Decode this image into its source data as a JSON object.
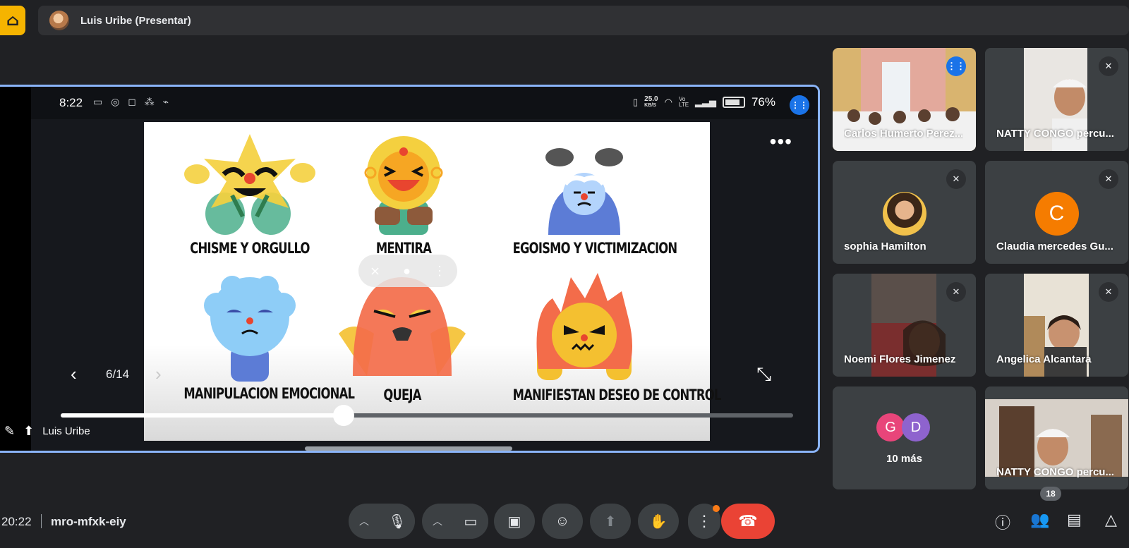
{
  "presenter_bar": {
    "logo_icon": "building-logo-icon",
    "title": "Luis Uribe (Presentar)"
  },
  "shared_screen": {
    "status_time": "8:22",
    "status_icons_left": "▭ ◎ ◻ ⁂ ⌁",
    "net_speed": "25.0",
    "net_unit": "KB/S",
    "network_label": "Vo LTE",
    "battery_pct": "76%",
    "slide_counter": "6/14",
    "slide_progress_fraction": 0.386,
    "presenter_name": "Luis Uribe",
    "slide": {
      "labels": [
        "CHISME Y ORGULLO",
        "MENTIRA",
        "EGOISMO Y VICTIMIZACION",
        "MANIPULACION EMOCIONAL",
        "QUEJA",
        "MANIFIESTAN DESEO DE CONTROL"
      ]
    }
  },
  "participants": [
    {
      "name": "Carlos Humerto Perez...",
      "mic": "speaking",
      "kind": "video"
    },
    {
      "name": "NATTY CONGO percu...",
      "mic": "muted",
      "kind": "video"
    },
    {
      "name": "sophia Hamilton",
      "mic": "muted",
      "kind": "photo"
    },
    {
      "name": "Claudia mercedes Gu...",
      "mic": "muted",
      "kind": "initial",
      "initial": "C",
      "color": "#f57c00"
    },
    {
      "name": "Noemi Flores Jimenez",
      "mic": "muted",
      "kind": "video"
    },
    {
      "name": "Angelica Alcantara",
      "mic": "muted",
      "kind": "video"
    },
    {
      "name": "10 más",
      "kind": "more",
      "initials": [
        "G",
        "D"
      ],
      "colors": [
        "#e8457a",
        "#8e63ce"
      ]
    },
    {
      "name": "NATTY CONGO percu...",
      "kind": "video"
    }
  ],
  "bottom_bar": {
    "time": "20:22",
    "meeting_code": "mro-mfxk-eiy",
    "people_count": "18"
  },
  "colors": {
    "background": "#202124",
    "tile": "#3c4043",
    "active_border": "#8ab4f8",
    "end_call": "#ea4335",
    "accent_blue": "#1a73e8"
  }
}
